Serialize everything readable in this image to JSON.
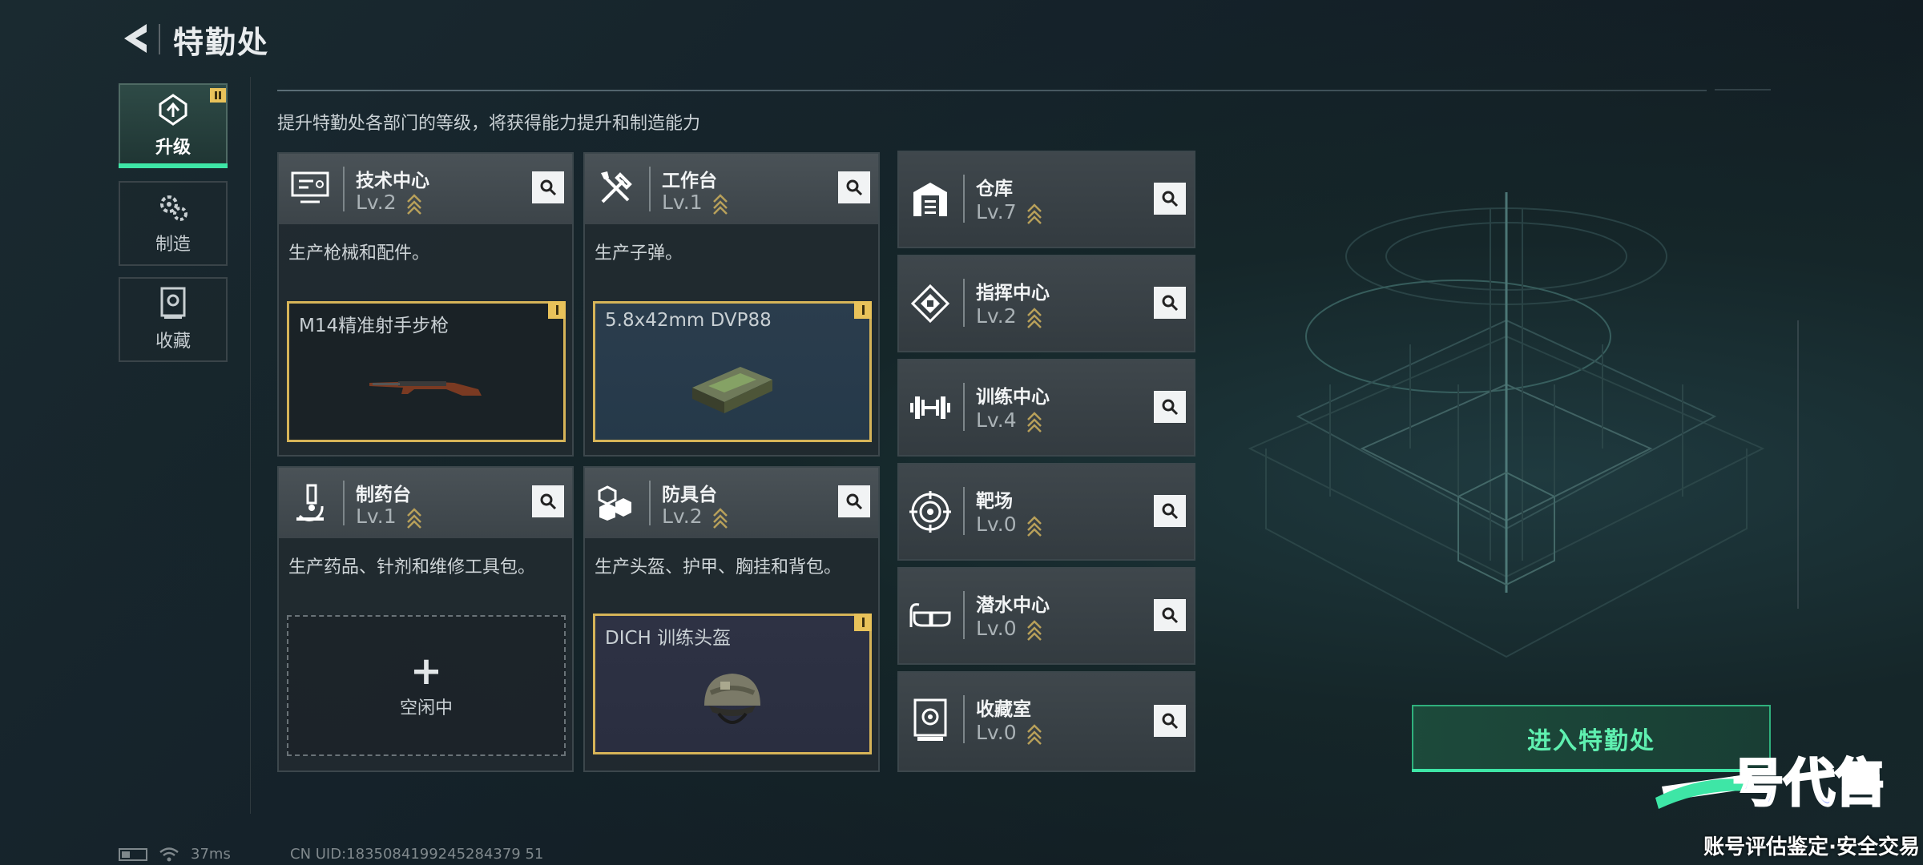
{
  "header": {
    "title": "特勤处"
  },
  "nav": [
    {
      "label": "升级",
      "icon": "upgrade-icon",
      "active": true
    },
    {
      "label": "制造",
      "icon": "gears-icon",
      "active": false
    },
    {
      "label": "收藏",
      "icon": "collection-icon",
      "active": false
    }
  ],
  "subtitle": "提升特勤处各部门的等级，将获得能力提升和制造能力",
  "cards": [
    {
      "name": "技术中心",
      "level": "Lv.2",
      "icon": "monitor-icon",
      "desc": "生产枪械和配件。",
      "product": "M14精准射手步枪",
      "product_icon": "rifle-icon"
    },
    {
      "name": "工作台",
      "level": "Lv.1",
      "icon": "tools-icon",
      "desc": "生产子弹。",
      "product": "5.8x42mm DVP88",
      "product_icon": "ammo-box-icon"
    },
    {
      "name": "制药台",
      "level": "Lv.1",
      "icon": "microscope-icon",
      "desc": "生产药品、针剂和维修工具包。",
      "idle_label": "空闲中"
    },
    {
      "name": "防具台",
      "level": "Lv.2",
      "icon": "armor-blocks-icon",
      "desc": "生产头盔、护甲、胸挂和背包。",
      "product": "DICH 训练头盔",
      "product_icon": "helmet-icon"
    }
  ],
  "small_cards": [
    {
      "name": "仓库",
      "level": "Lv.7",
      "icon": "warehouse-icon"
    },
    {
      "name": "指挥中心",
      "level": "Lv.2",
      "icon": "command-icon"
    },
    {
      "name": "训练中心",
      "level": "Lv.4",
      "icon": "dumbbell-icon"
    },
    {
      "name": "靶场",
      "level": "Lv.0",
      "icon": "target-icon"
    },
    {
      "name": "潜水中心",
      "level": "Lv.0",
      "icon": "goggles-icon"
    },
    {
      "name": "收藏室",
      "level": "Lv.0",
      "icon": "vault-icon"
    }
  ],
  "enter_button": "进入特勤处",
  "status": {
    "ping": "37ms",
    "uid": "CN UID:1835084199245284379 51"
  },
  "watermark": {
    "logo_text": "一号代售",
    "tagline": "账号评估鉴定·安全交易"
  },
  "colors": {
    "accent_green": "#3ee6a6",
    "gold": "#d6b458",
    "level_chevron": "#b8a05a"
  }
}
